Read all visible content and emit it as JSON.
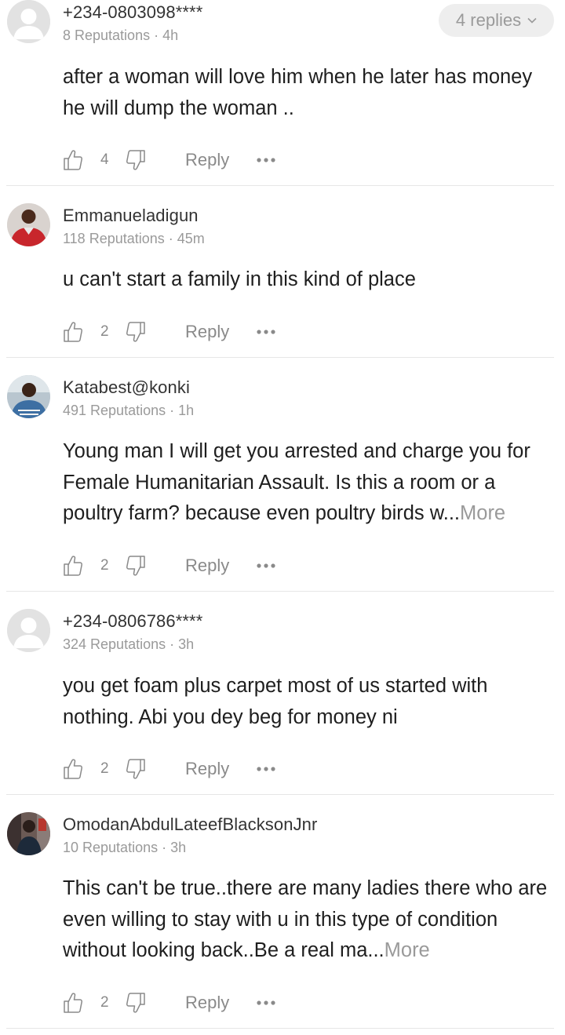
{
  "comments": [
    {
      "username": "+234-0803098****",
      "reputation": "8 Reputations",
      "time": "4h",
      "text": "after a woman will love him when he later has money he will dump the woman ..",
      "likes": "4",
      "reply_label": "Reply",
      "replies_label": "4 replies",
      "avatar": "default-avatar",
      "truncated": false
    },
    {
      "username": "Emmanueladigun",
      "reputation": "118 Reputations",
      "time": "45m",
      "text": "u can't start a family in this kind of place",
      "likes": "2",
      "reply_label": "Reply",
      "avatar": "photo-avatar-red",
      "truncated": false
    },
    {
      "username": "Katabest@konki",
      "reputation": "491 Reputations",
      "time": "1h",
      "text": "Young man I will get you arrested and charge you for Female Humanitarian Assault. Is this a room or a poultry farm? because even poultry birds w...",
      "more_label": "More",
      "likes": "2",
      "reply_label": "Reply",
      "avatar": "photo-avatar-blue",
      "truncated": true
    },
    {
      "username": "+234-0806786****",
      "reputation": "324 Reputations",
      "time": "3h",
      "text": "you get foam plus carpet most of us started with nothing. Abi you dey beg for money ni",
      "likes": "2",
      "reply_label": "Reply",
      "avatar": "default-avatar",
      "truncated": false
    },
    {
      "username": "OmodanAbdulLateefBlacksonJnr",
      "reputation": "10 Reputations",
      "time": "3h",
      "text": "This can't be true..there are many ladies there who are even willing to stay with u in this type of condition without looking back..Be a real ma...",
      "more_label": "More",
      "likes": "2",
      "reply_label": "Reply",
      "avatar": "photo-avatar-dark",
      "truncated": true
    }
  ],
  "separator": " · ",
  "colors": {
    "text": "#1e1e1e",
    "muted": "#9a9a9a",
    "divider": "#e6e6e6",
    "pill_bg": "#eeeeee"
  }
}
